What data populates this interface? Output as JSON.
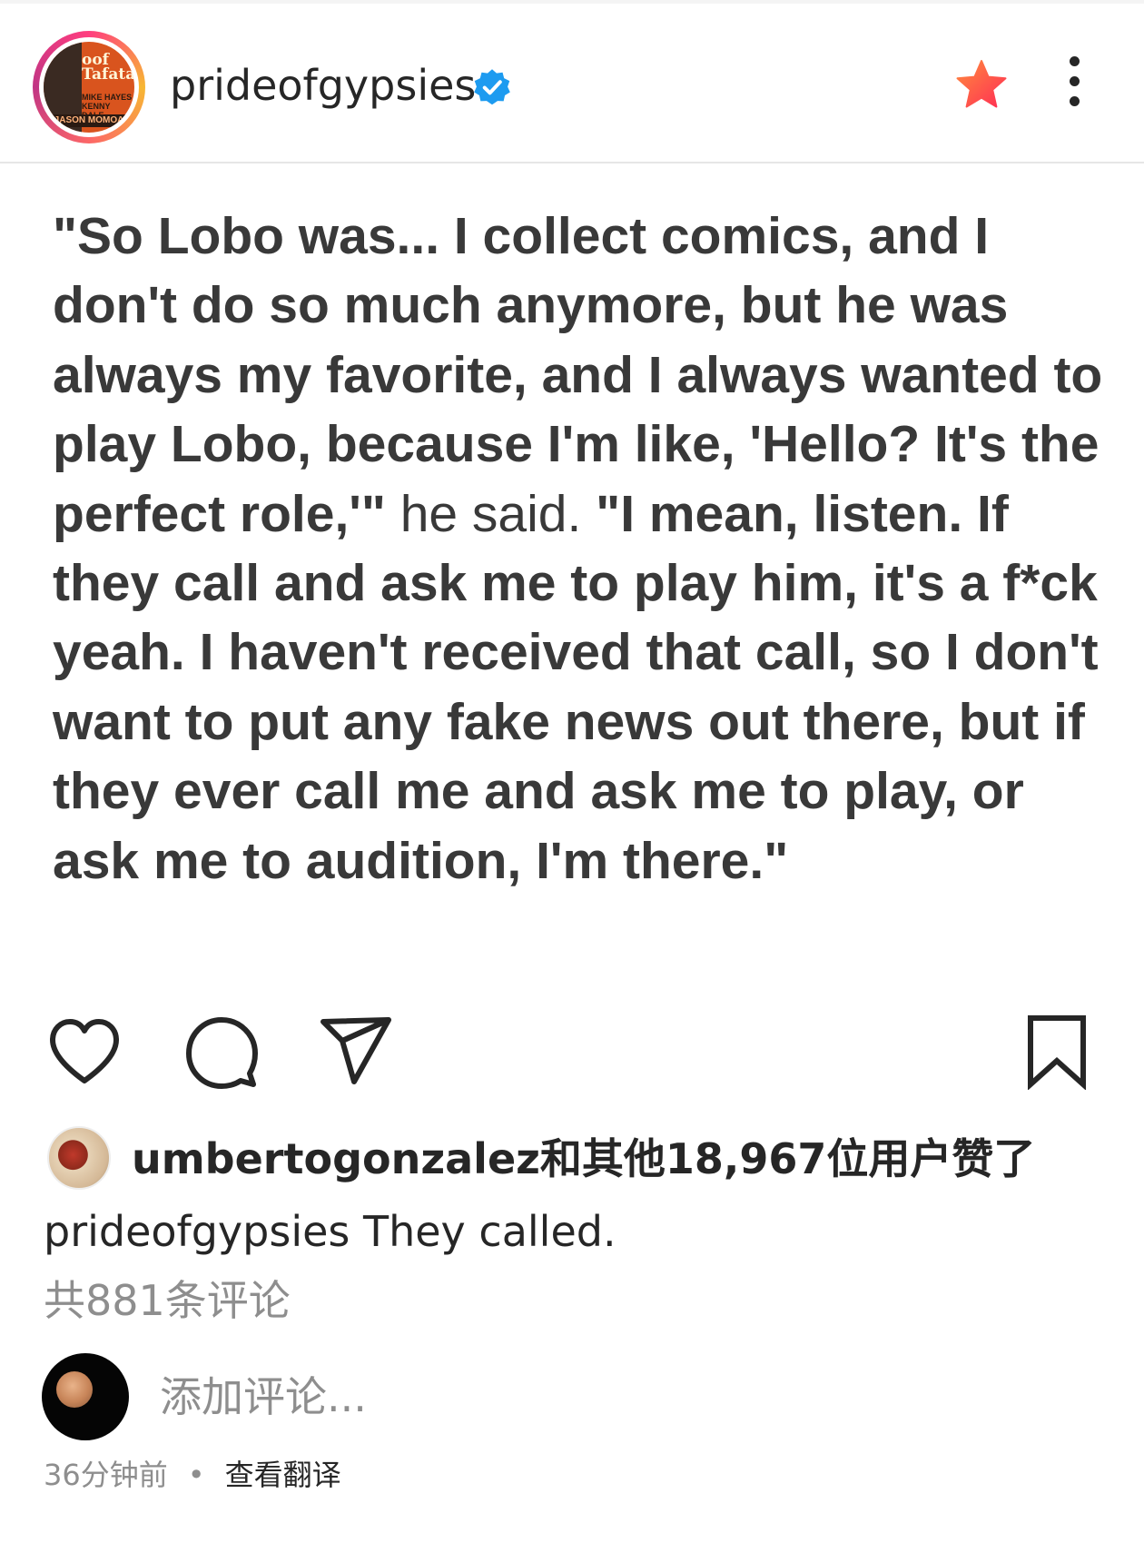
{
  "header": {
    "username": "prideofgypsies",
    "verified": true,
    "avatar_poster_text": [
      "oof Tafata",
      "MIKE HAYES",
      "KENNY DALE",
      "JASON MOMOA"
    ]
  },
  "post": {
    "text_segments": [
      {
        "text": "\"So Lobo was... I collect comics, and I don't do so much anymore, but he was always my favorite, and I always wanted to play Lobo, because I'm like, 'Hello? It's the perfect role,'\"",
        "weight": "bold"
      },
      {
        "text": " he said. ",
        "weight": "normal"
      },
      {
        "text": "\"I mean, listen. If they call and ask me to play him, it's a f*ck yeah. I haven't received that call, so I don't want to put any fake news out there, but if they ever call me and ask me to play, or ask me to audition, I'm there.\"",
        "weight": "bold"
      }
    ]
  },
  "actions": {
    "like_icon": "heart-outline",
    "comment_icon": "speech-bubble",
    "share_icon": "paper-plane",
    "save_icon": "bookmark-outline"
  },
  "likes": {
    "text": "umbertogonzalez和其他18,967位用户赞了"
  },
  "caption": {
    "username": "prideofgypsies",
    "text": "They called."
  },
  "comments": {
    "count_text": "共881条评论",
    "add_placeholder": "添加评论..."
  },
  "meta": {
    "time_ago": "36分钟前",
    "separator": "•",
    "translate": "查看翻译"
  },
  "colors": {
    "text": "#262626",
    "secondary": "#8e8e8e",
    "verified": "#1d9bf0",
    "star_gradient": [
      "#ff7a45",
      "#ff2d55"
    ]
  }
}
